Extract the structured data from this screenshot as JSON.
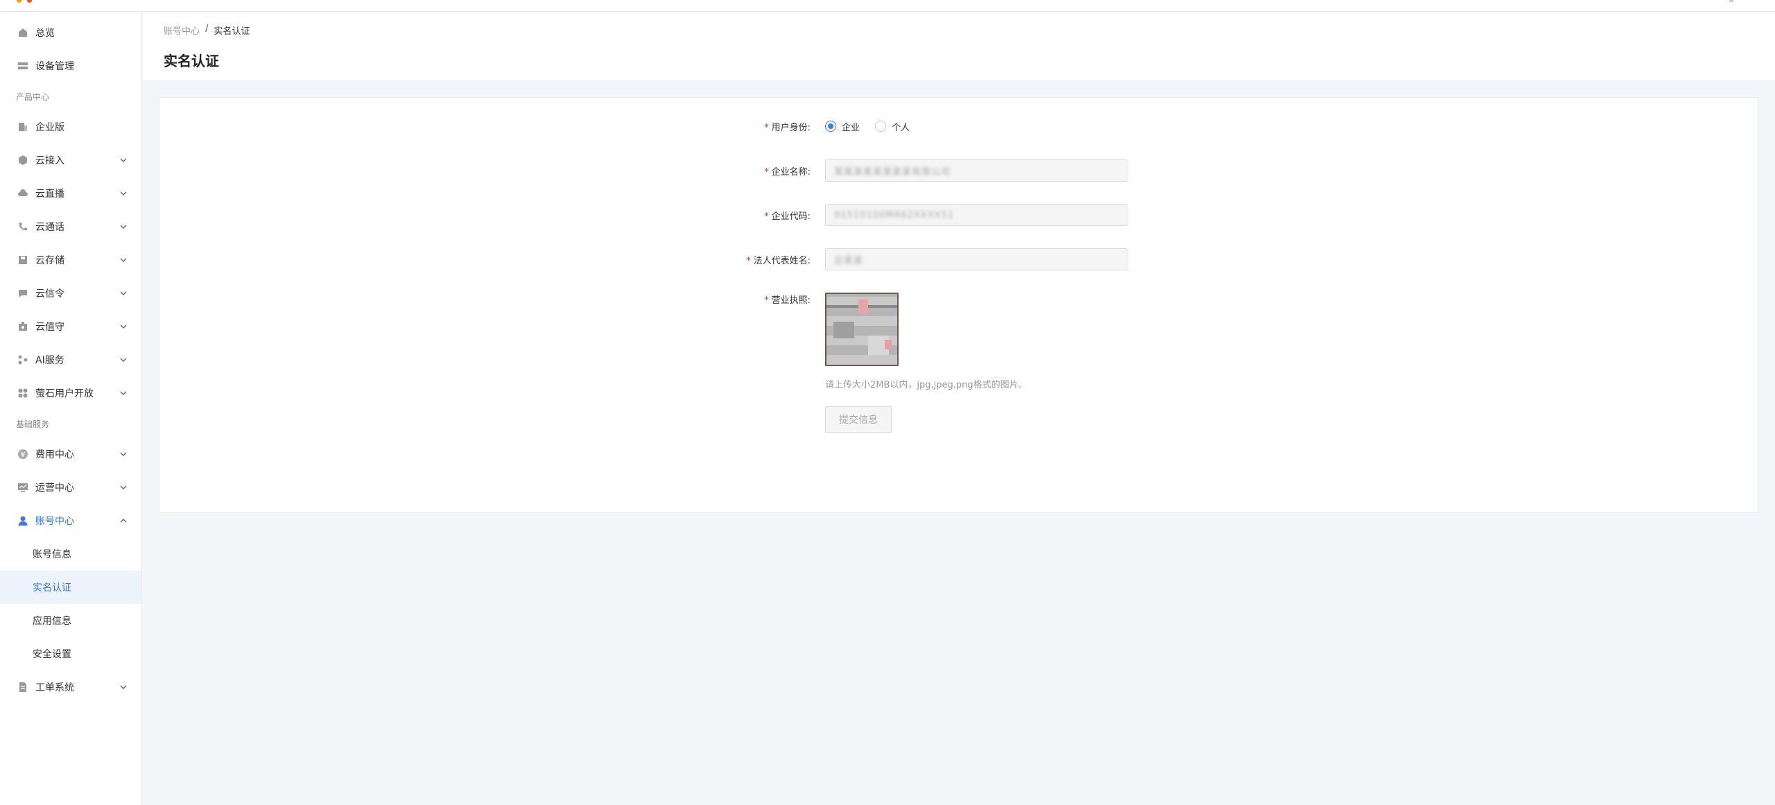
{
  "sidebar": {
    "items": [
      {
        "label": "总览",
        "icon": "home-icon"
      },
      {
        "label": "设备管理",
        "icon": "device-icon"
      }
    ],
    "section_product": "产品中心",
    "product_items": [
      {
        "label": "企业版",
        "icon": "building-icon"
      },
      {
        "label": "云接入",
        "icon": "cloud-access-icon"
      },
      {
        "label": "云直播",
        "icon": "cloud-live-icon"
      },
      {
        "label": "云通话",
        "icon": "phone-icon"
      },
      {
        "label": "云存储",
        "icon": "storage-icon"
      },
      {
        "label": "云信令",
        "icon": "message-icon"
      },
      {
        "label": "云值守",
        "icon": "guard-icon"
      },
      {
        "label": "AI服务",
        "icon": "ai-icon"
      },
      {
        "label": "萤石用户开放",
        "icon": "users-open-icon"
      }
    ],
    "section_basic": "基础服务",
    "basic_items": [
      {
        "label": "费用中心",
        "icon": "fee-icon"
      },
      {
        "label": "运营中心",
        "icon": "operations-icon"
      },
      {
        "label": "账号中心",
        "icon": "account-icon"
      }
    ],
    "account_sub": [
      "账号信息",
      "实名认证",
      "应用信息",
      "安全设置"
    ],
    "ticket": {
      "label": "工单系统",
      "icon": "ticket-icon"
    }
  },
  "breadcrumb": {
    "parent": "账号中心",
    "sep": "/",
    "current": "实名认证"
  },
  "page_title": "实名认证",
  "form": {
    "identity_label": "用户身份",
    "identity_options": [
      "企业",
      "个人"
    ],
    "company_name_label": "企业名称",
    "company_name_value": "某某某某某某某某有限公司",
    "company_code_label": "企业代码",
    "company_code_value": "91510100MA62XXXX51",
    "legal_rep_label": "法人代表姓名",
    "legal_rep_value": "吕某某",
    "license_label": "营业执照",
    "upload_hint": "请上传大小2MB以内，jpg,jpeg,png格式的图片。",
    "submit_label": "提交信息"
  },
  "colors": {
    "accent": "#3a78e7",
    "required": "#f5222d"
  }
}
